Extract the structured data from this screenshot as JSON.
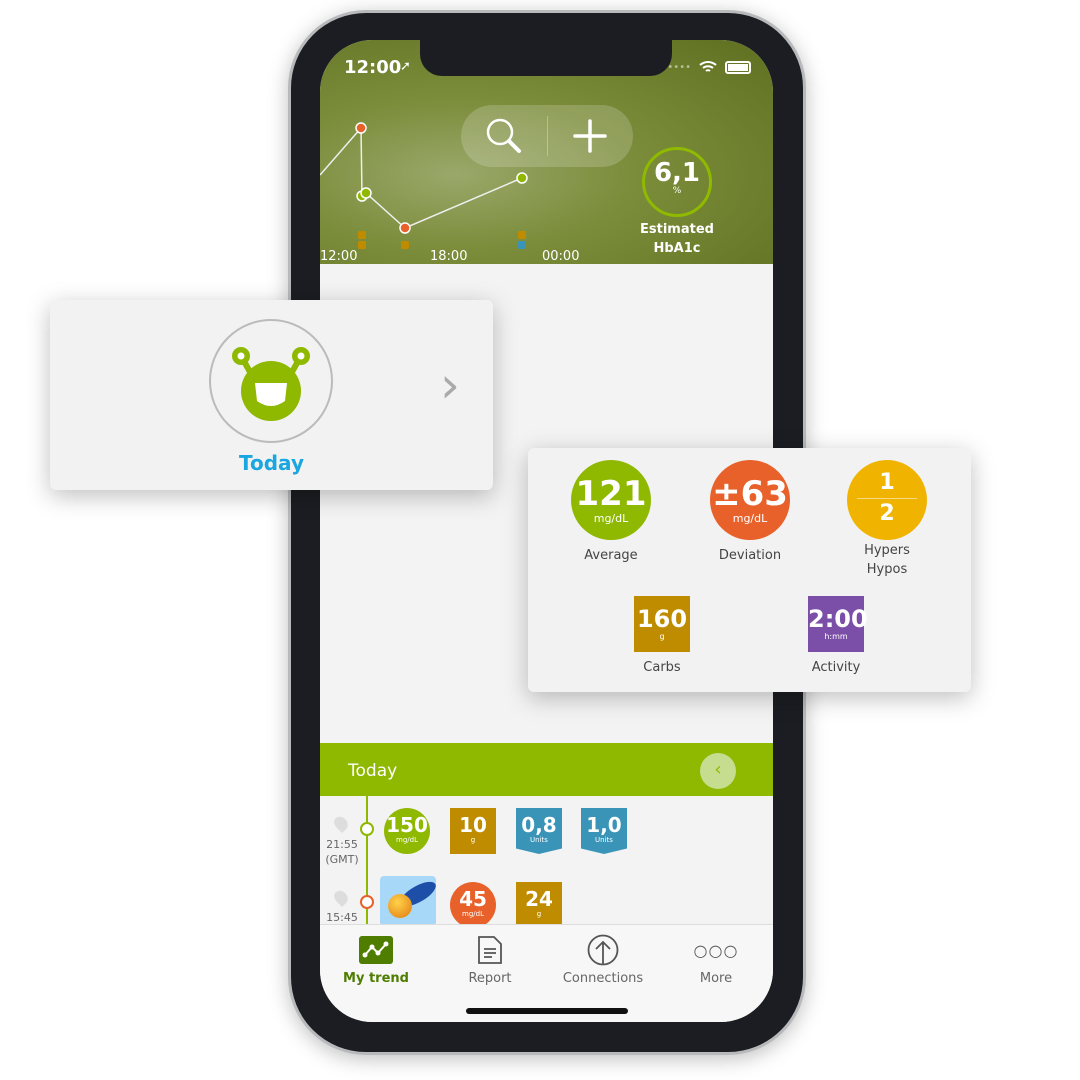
{
  "status_bar": {
    "time": "12:00"
  },
  "header": {
    "x_ticks": [
      "12:00",
      "18:00",
      "00:00"
    ],
    "hba1c": {
      "value": "6,1",
      "unit": "%",
      "label_line1": "Estimated",
      "label_line2": "HbA1c"
    },
    "icons": [
      "search-icon",
      "plus-icon"
    ]
  },
  "today_card": {
    "label": "Today",
    "icon": "monster-mascot-icon"
  },
  "stats_card": {
    "average": {
      "value": "121",
      "unit": "mg/dL",
      "label": "Average",
      "color": "#8fb800"
    },
    "deviation": {
      "value": "±63",
      "unit": "mg/dL",
      "label": "Deviation",
      "color": "#e8612a"
    },
    "hypers_hypos": {
      "hypers": "1",
      "hypos": "2",
      "label1": "Hypers",
      "label2": "Hypos",
      "color": "#f0b400"
    },
    "carbs": {
      "value": "160",
      "unit": "g",
      "label": "Carbs",
      "color": "#bf8c00"
    },
    "activity": {
      "value": "2:00",
      "unit": "h:mm",
      "label": "Activity",
      "color": "#7b4fa8"
    }
  },
  "log": {
    "section_title": "Today",
    "entries": [
      {
        "time": "21:55",
        "tz": "(GMT)",
        "glucose": {
          "value": "150",
          "unit": "mg/dL"
        },
        "carbs": {
          "value": "10",
          "unit": "g"
        },
        "insulin": [
          {
            "value": "0,8",
            "unit": "Units"
          },
          {
            "value": "1,0",
            "unit": "Units"
          }
        ]
      },
      {
        "time": "15:45",
        "glucose": {
          "value": "45",
          "unit": "mg/dL"
        },
        "carbs": {
          "value": "24",
          "unit": "g"
        }
      }
    ]
  },
  "tabbar": {
    "tabs": [
      {
        "label": "My trend",
        "active": true
      },
      {
        "label": "Report"
      },
      {
        "label": "Connections"
      },
      {
        "label": "More"
      }
    ]
  },
  "colors": {
    "green": "#8fb800",
    "orange": "#e8612a",
    "carbs": "#bf8c00",
    "insulin": "#3a94b8",
    "active_tab": "#4f7d00"
  }
}
